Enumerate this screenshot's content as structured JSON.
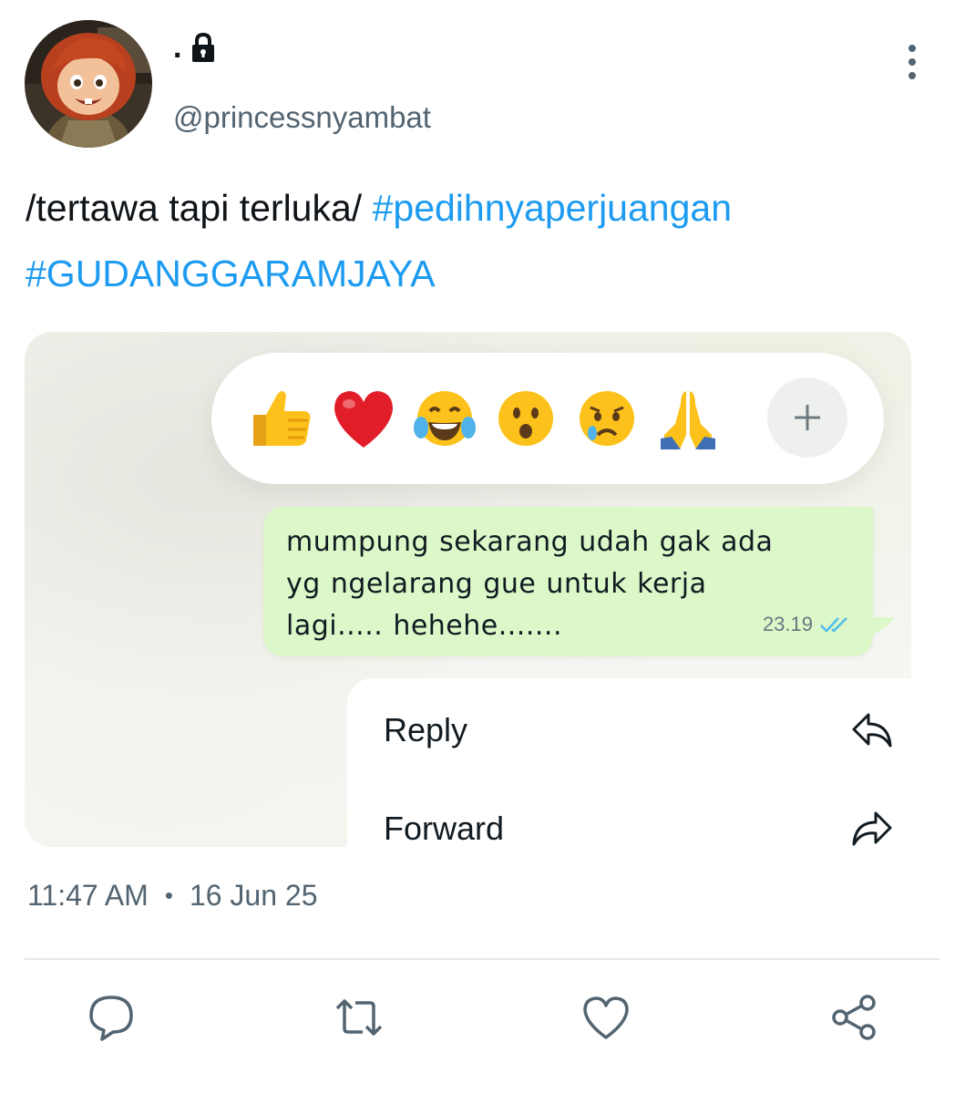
{
  "author": {
    "display_name": ".",
    "handle": "@princessnyambat",
    "protected_icon": "lock-icon"
  },
  "tweet": {
    "text": "/tertawa tapi terluka/",
    "hashtags": [
      "#pedihnyaperjuangan",
      "#GUDANGGARAMJAYA"
    ],
    "time": "11:47 AM",
    "separator": "•",
    "date": "16 Jun 25"
  },
  "media": {
    "reactions": [
      "thumbs-up",
      "red-heart",
      "tears-of-joy",
      "surprised-face",
      "crying-face",
      "folded-hands"
    ],
    "add_reaction_icon": "plus-icon",
    "message": {
      "lines": [
        "mumpung sekarang udah gak ada",
        "yg ngelarang gue untuk kerja",
        "lagi..... hehehe......."
      ],
      "time": "23.19",
      "status_icon": "double-check-icon",
      "bubble_color": "#dcf7c8"
    },
    "menu": [
      {
        "label": "Reply",
        "icon": "reply-icon"
      },
      {
        "label": "Forward",
        "icon": "forward-icon"
      }
    ]
  },
  "actions": [
    "reply-icon",
    "retweet-icon",
    "like-icon",
    "share-icon"
  ],
  "colors": {
    "hashtag": "#1d9bf0",
    "secondary_text": "#536471",
    "divider": "#e5e8eb"
  }
}
